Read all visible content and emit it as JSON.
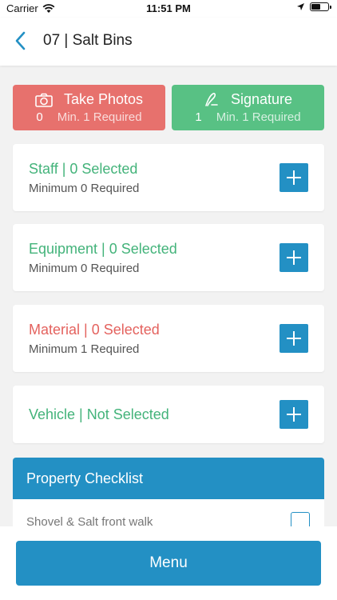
{
  "status_bar": {
    "carrier": "Carrier",
    "time": "11:51 PM"
  },
  "nav": {
    "title": "07 | Salt Bins",
    "back_icon": "chevron-left-icon"
  },
  "actions": {
    "photos": {
      "label": "Take Photos",
      "count": "0",
      "requirement": "Min. 1 Required",
      "icon": "camera-icon",
      "color": "#e7716d"
    },
    "signature": {
      "label": "Signature",
      "count": "1",
      "requirement": "Min. 1 Required",
      "icon": "signature-pen-icon",
      "color": "#58c184"
    }
  },
  "sections": {
    "staff": {
      "title": "Staff | 0 Selected",
      "subtitle": "Minimum 0 Required"
    },
    "equipment": {
      "title": "Equipment | 0 Selected",
      "subtitle": "Minimum 0 Required"
    },
    "material": {
      "title": "Material | 0 Selected",
      "subtitle": "Minimum 1 Required"
    },
    "vehicle": {
      "title": "Vehicle | Not Selected"
    }
  },
  "checklist": {
    "header": "Property Checklist",
    "items": [
      {
        "label": "Shovel & Salt front walk",
        "checked": false
      }
    ]
  },
  "menu_label": "Menu",
  "colors": {
    "accent": "#2390c4",
    "ok": "#43b37a",
    "warning": "#e4625e"
  }
}
